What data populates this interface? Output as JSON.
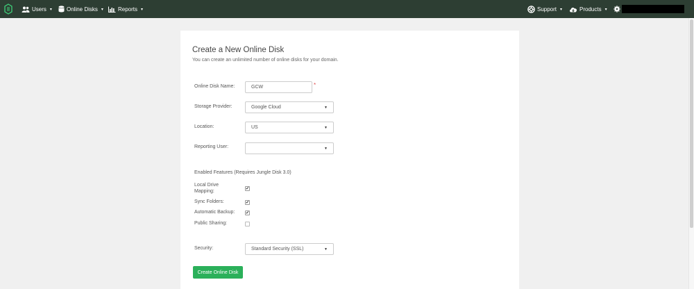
{
  "nav": {
    "users_label": "Users",
    "disks_label": "Online Disks",
    "reports_label": "Reports",
    "support_label": "Support",
    "products_label": "Products",
    "caret": "▾"
  },
  "form": {
    "title": "Create a New Online Disk",
    "subtitle": "You can create an unlimited number of online disks for your domain.",
    "disk_name_label": "Online Disk Name:",
    "disk_name_value": "GCW",
    "required_mark": "*",
    "storage_provider_label": "Storage Provider:",
    "storage_provider_value": "Google Cloud",
    "location_label": "Location:",
    "location_value": "US",
    "reporting_user_label": "Reporting User:",
    "reporting_user_value": "",
    "features_label": "Enabled Features (Requires Jungle Disk 3.0)",
    "features": [
      {
        "label": "Local Drive Mapping:",
        "checked": true
      },
      {
        "label": "Sync Folders:",
        "checked": true
      },
      {
        "label": "Automatic Backup:",
        "checked": true
      },
      {
        "label": "Public Sharing:",
        "checked": false
      }
    ],
    "security_label": "Security:",
    "security_value": "Standard Security (SSL)",
    "submit_label": "Create Online Disk",
    "check_mark": "✔",
    "select_arrow": "▼"
  },
  "colors": {
    "navbar": "#2d3e33",
    "primary_button": "#2bb05a",
    "required": "#e05050"
  }
}
